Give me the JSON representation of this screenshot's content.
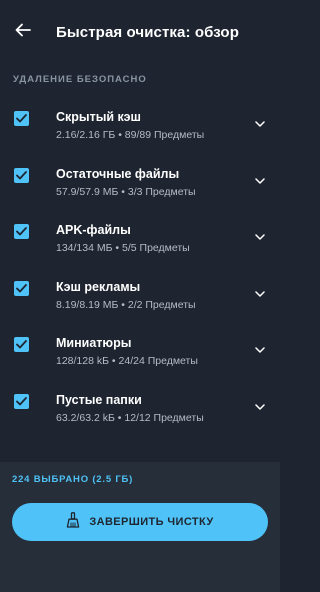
{
  "header": {
    "back_icon": "arrow-left-icon",
    "title": "Быстрая очистка: обзор"
  },
  "section": {
    "label": "УДАЛЕНИЕ БЕЗОПАСНО"
  },
  "items": [
    {
      "name": "Скрытый кэш",
      "details": "2.16/2.16 ГБ • 89/89 Предметы",
      "checked": true
    },
    {
      "name": "Остаточные файлы",
      "details": "57.9/57.9 МБ • 3/3 Предметы",
      "checked": true
    },
    {
      "name": "APK-файлы",
      "details": "134/134 МБ • 5/5 Предметы",
      "checked": true
    },
    {
      "name": "Кэш рекламы",
      "details": "8.19/8.19 МБ • 2/2 Предметы",
      "checked": true
    },
    {
      "name": "Миниатюры",
      "details": "128/128 kБ • 24/24 Предметы",
      "checked": true
    },
    {
      "name": "Пустые папки",
      "details": "63.2/63.2 kБ • 12/12 Предметы",
      "checked": true
    }
  ],
  "footer": {
    "selected_summary": "224 ВЫБРАНО (2.5 ГБ)",
    "finish_label": "ЗАВЕРШИТЬ ЧИСТКУ",
    "finish_icon": "broom-icon"
  },
  "colors": {
    "background": "#1e2530",
    "footer_background": "#262e3a",
    "accent": "#4fc3f7"
  }
}
